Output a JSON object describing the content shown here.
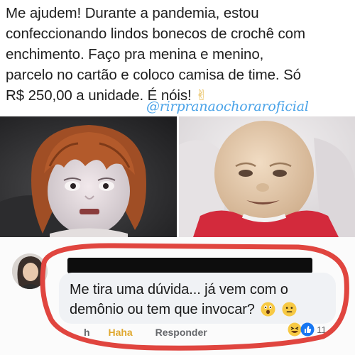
{
  "post": {
    "lines": [
      "Me ajudem! Durante a pandemia, estou",
      "confeccionando lindos bonecos de crochê com",
      "enchimento. Faço pra menina e menino,",
      "parcelo no cartão e coloco camisa de time. Só",
      "R$ 250,00 a unidade. É nóis!"
    ],
    "emoji": "✌"
  },
  "watermark": "@rirpranaochoraroficial",
  "photo_caption_fragment": "Responder",
  "comment": {
    "lines": [
      "Me tira uma dúvida... já vem com o",
      "demônio ou tem que invocar?"
    ]
  },
  "actions": {
    "like": "h",
    "haha": "Haha",
    "reply": "Responder"
  },
  "reaction_count": "11",
  "colors": {
    "watermark": "#4aa3e8",
    "highlight": "#e0453f",
    "haha": "#e0a82e"
  }
}
